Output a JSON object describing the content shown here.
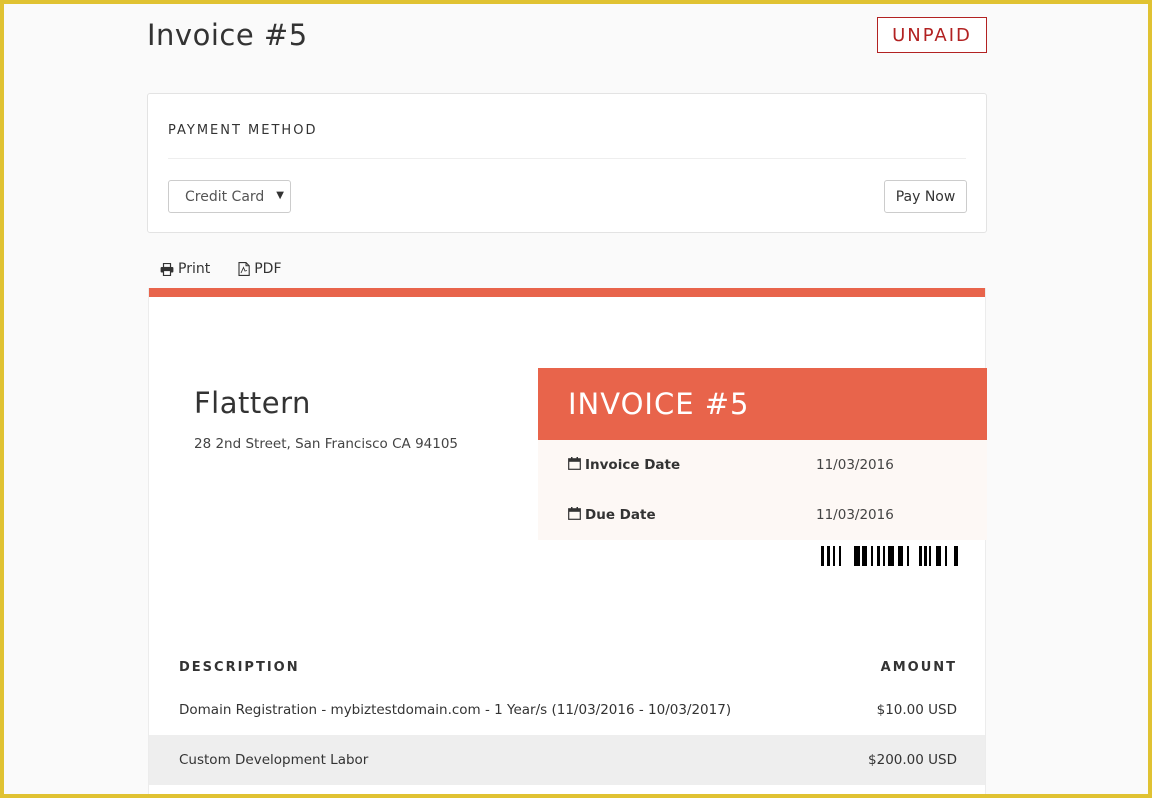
{
  "header": {
    "title": "Invoice #5",
    "status": "UNPAID"
  },
  "payment": {
    "title": "PAYMENT METHOD",
    "selected_method": "Credit Card",
    "pay_label": "Pay Now"
  },
  "toolbar": {
    "print_label": "Print",
    "pdf_label": "PDF"
  },
  "company": {
    "name": "Flattern",
    "address": "28 2nd Street, San Francisco CA 94105"
  },
  "invoice": {
    "heading": "INVOICE #5",
    "invoice_date_label": "Invoice Date",
    "invoice_date": "11/03/2016",
    "due_date_label": "Due Date",
    "due_date": "11/03/2016"
  },
  "items": {
    "header_description": "DESCRIPTION",
    "header_amount": "AMOUNT",
    "rows": [
      {
        "description": "Domain Registration - mybiztestdomain.com - 1 Year/s (11/03/2016 - 10/03/2017)",
        "amount": "$10.00 USD"
      },
      {
        "description": "Custom Development Labor",
        "amount": "$200.00 USD"
      }
    ]
  },
  "colors": {
    "accent": "#e8644b",
    "status_unpaid": "#b22222",
    "frame": "#e0c232"
  },
  "icons": {
    "print": "printer-icon",
    "pdf": "pdf-file-icon",
    "date": "calendar-icon",
    "select": "caret-down-icon"
  }
}
